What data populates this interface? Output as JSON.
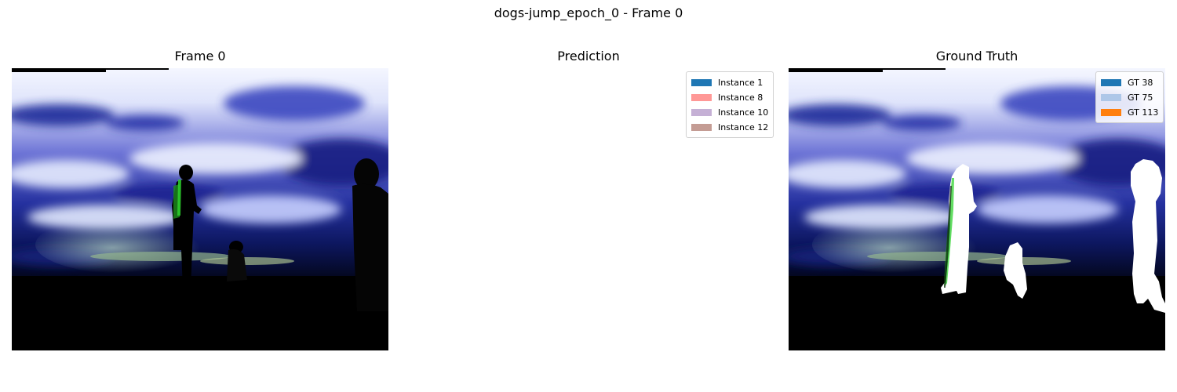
{
  "figure": {
    "title": "dogs-jump_epoch_0 - Frame 0"
  },
  "panels": [
    {
      "title": "Frame 0"
    },
    {
      "title": "Prediction"
    },
    {
      "title": "Ground Truth"
    }
  ],
  "prediction_legend": [
    {
      "label": "Instance 1",
      "color": "#1f77b4"
    },
    {
      "label": "Instance 8",
      "color": "#ff9896"
    },
    {
      "label": "Instance 10",
      "color": "#c5b0d5"
    },
    {
      "label": "Instance 12",
      "color": "#c49c94"
    }
  ],
  "ground_truth_legend": [
    {
      "label": "GT 38",
      "color": "#1f77b4"
    },
    {
      "label": "GT 75",
      "color": "#aec7e8"
    },
    {
      "label": "GT 113",
      "color": "#ff7f0e"
    }
  ],
  "mask_color": "#ffffff",
  "highlight_color": "#2ed12e"
}
